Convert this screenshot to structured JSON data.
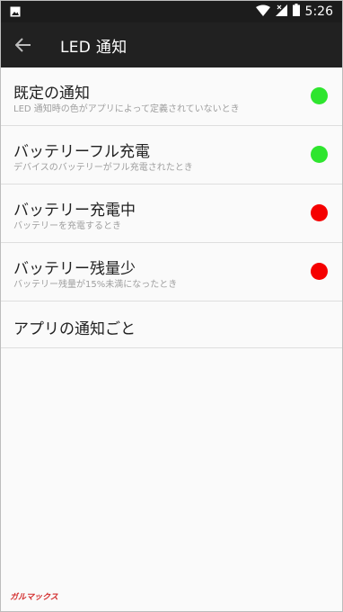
{
  "statusbar": {
    "time": "5:26"
  },
  "appbar": {
    "title": "LED 通知"
  },
  "colors": {
    "green": "#2ee52e",
    "red": "#f50000"
  },
  "items": [
    {
      "title": "既定の通知",
      "subtitle": "LED 通知時の色がアプリによって定義されていないとき",
      "led": "green"
    },
    {
      "title": "バッテリーフル充電",
      "subtitle": "デバイスのバッテリーがフル充電されたとき",
      "led": "green"
    },
    {
      "title": "バッテリー充電中",
      "subtitle": "バッテリーを充電するとき",
      "led": "red"
    },
    {
      "title": "バッテリー残量少",
      "subtitle": "バッテリー残量が15%未満になったとき",
      "led": "red"
    },
    {
      "title": "アプリの通知ごと"
    }
  ],
  "watermark": "ガルマックス"
}
